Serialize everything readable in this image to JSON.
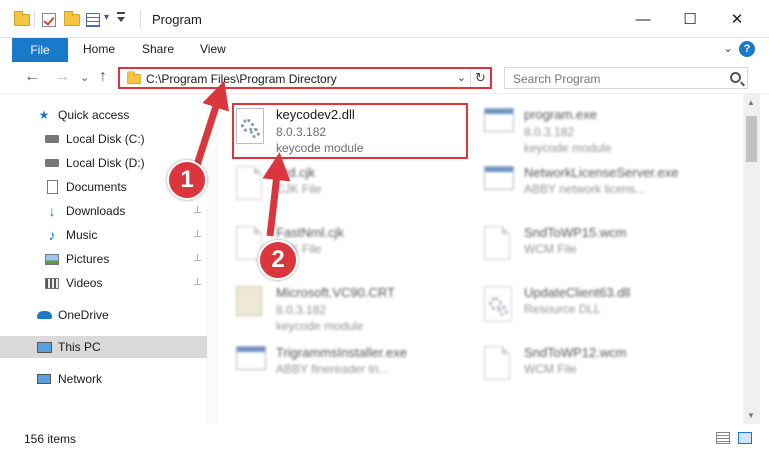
{
  "window": {
    "title": "Program",
    "minimize": "—",
    "maximize": "☐",
    "close": "✕"
  },
  "quick_access_toolbar": {
    "dropdown": "▾"
  },
  "ribbon": {
    "file_tab": "File",
    "tabs": [
      "Home",
      "Share",
      "View"
    ],
    "expand": "⌄",
    "help": "?"
  },
  "nav": {
    "back": "←",
    "forward": "→",
    "recent": "⌄",
    "up": "↑",
    "address_path": "C:\\Program Files\\Program Directory",
    "address_dropdown": "⌄",
    "refresh": "↻",
    "search_placeholder": "Search Program"
  },
  "sidebar": {
    "items": [
      {
        "label": "Quick access",
        "icon": "star-icon",
        "pinned": false
      },
      {
        "label": "Local Disk (C:)",
        "icon": "drive-icon",
        "pinned": true
      },
      {
        "label": "Local Disk (D:)",
        "icon": "drive-icon",
        "pinned": true
      },
      {
        "label": "Documents",
        "icon": "documents-icon",
        "pinned": true
      },
      {
        "label": "Downloads",
        "icon": "download-icon",
        "pinned": true
      },
      {
        "label": "Music",
        "icon": "music-icon",
        "pinned": true
      },
      {
        "label": "Pictures",
        "icon": "pictures-icon",
        "pinned": true
      },
      {
        "label": "Videos",
        "icon": "videos-icon",
        "pinned": true
      },
      {
        "label": "OneDrive",
        "icon": "cloud-icon",
        "pinned": false
      },
      {
        "label": "This PC",
        "icon": "computer-icon",
        "pinned": false,
        "active": true
      },
      {
        "label": "Network",
        "icon": "network-icon",
        "pinned": false
      }
    ],
    "pin_glyph": "📌"
  },
  "files": {
    "left": [
      {
        "name": "keycodev2.dll",
        "version": "8.0.3.182",
        "desc": "keycode module",
        "icon": "gear-document-icon"
      },
      {
        "name": "Btd.cjk",
        "version": "",
        "desc": "CJK File",
        "icon": "document-icon"
      },
      {
        "name": "FastNml.cjk",
        "version": "",
        "desc": "CJK File",
        "icon": "document-icon"
      },
      {
        "name": "Microsoft.VC90.CRT",
        "version": "8.0.3.182",
        "desc": "keycode module",
        "icon": "folder-icon"
      },
      {
        "name": "TrigrammsInstaller.exe",
        "version": "",
        "desc": "ABBY finereader tri...",
        "icon": "exe-icon"
      }
    ],
    "right": [
      {
        "name": "program.exe",
        "version": "8.0.3.182",
        "desc": "keycode module",
        "icon": "exe-icon"
      },
      {
        "name": "NetworkLicenseServer.exe",
        "version": "",
        "desc": "ABBY network licens...",
        "icon": "exe-icon"
      },
      {
        "name": "SndToWP15.wcm",
        "version": "",
        "desc": "WCM File",
        "icon": "document-icon"
      },
      {
        "name": "UpdateClient63.dll",
        "version": "",
        "desc": "Resource DLL",
        "icon": "gear-document-icon"
      },
      {
        "name": "SndToWP12.wcm",
        "version": "",
        "desc": "WCM File",
        "icon": "document-icon"
      }
    ]
  },
  "status": {
    "item_count": "156 items"
  },
  "annotations": {
    "badge1": "1",
    "badge2": "2",
    "color": "#d9363e"
  }
}
